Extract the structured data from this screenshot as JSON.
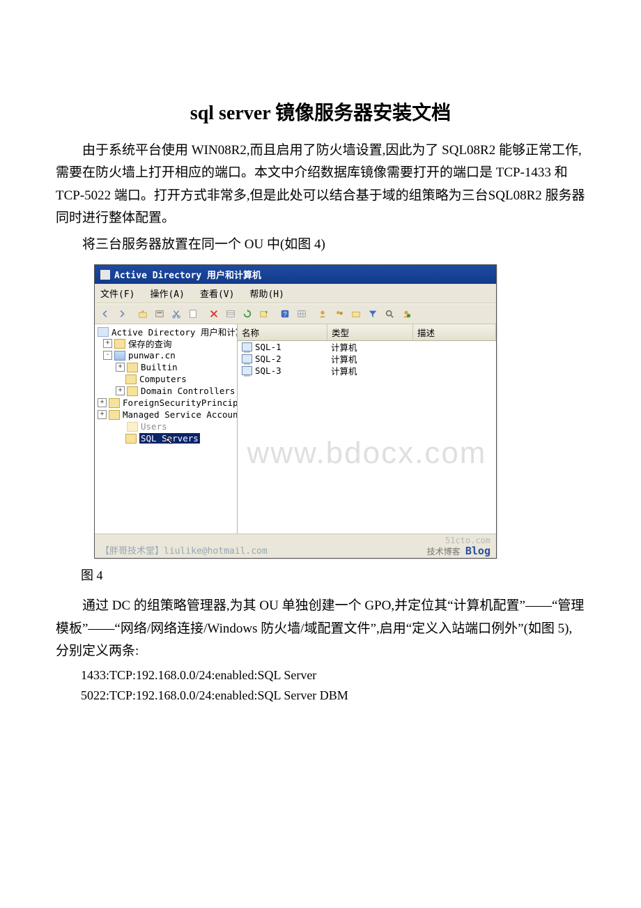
{
  "doc": {
    "title": "sql server 镜像服务器安装文档",
    "para1": "由于系统平台使用 WIN08R2,而且启用了防火墙设置,因此为了 SQL08R2 能够正常工作,需要在防火墙上打开相应的端口。本文中介绍数据库镜像需要打开的端口是 TCP-1433 和 TCP-5022 端口。打开方式非常多,但是此处可以结合基于域的组策略为三台SQL08R2 服务器同时进行整体配置。",
    "para2": "将三台服务器放置在同一个 OU 中(如图 4)",
    "fig_caption": "图 4",
    "para3": "通过 DC 的组策略管理器,为其 OU 单独创建一个 GPO,并定位其“计算机配置”——“管理模板”——“网络/网络连接/Windows 防火墙/域配置文件”,启用“定义入站端口例外”(如图 5),分别定义两条:",
    "code1": "1433:TCP:192.168.0.0/24:enabled:SQL Server",
    "code2": "5022:TCP:192.168.0.0/24:enabled:SQL Server DBM"
  },
  "aduc": {
    "title": "Active Directory 用户和计算机",
    "menu": {
      "file": "文件(F)",
      "action": "操作(A)",
      "view": "查看(V)",
      "help": "帮助(H)"
    },
    "tree": {
      "root": "Active Directory 用户和计算机",
      "saved_queries": "保存的查询",
      "domain": "punwar.cn",
      "builtin": "Builtin",
      "computers": "Computers",
      "dc": "Domain Controllers",
      "fsp": "ForeignSecurityPrincip",
      "msa": "Managed Service Accoun",
      "users": "Users",
      "sql_ou": "SQL Servers"
    },
    "list": {
      "cols": {
        "name": "名称",
        "type": "类型",
        "desc": "描述"
      },
      "rows": [
        {
          "name": "SQL-1",
          "type": "计算机"
        },
        {
          "name": "SQL-2",
          "type": "计算机"
        },
        {
          "name": "SQL-3",
          "type": "计算机"
        }
      ]
    },
    "watermark": "www.bdocx.com",
    "footer_left": "【胖哥技术堂】liulike@hotmail.com",
    "footer_site": "51cto.com",
    "footer_sub": "技术博客",
    "footer_blog": "Blog"
  }
}
